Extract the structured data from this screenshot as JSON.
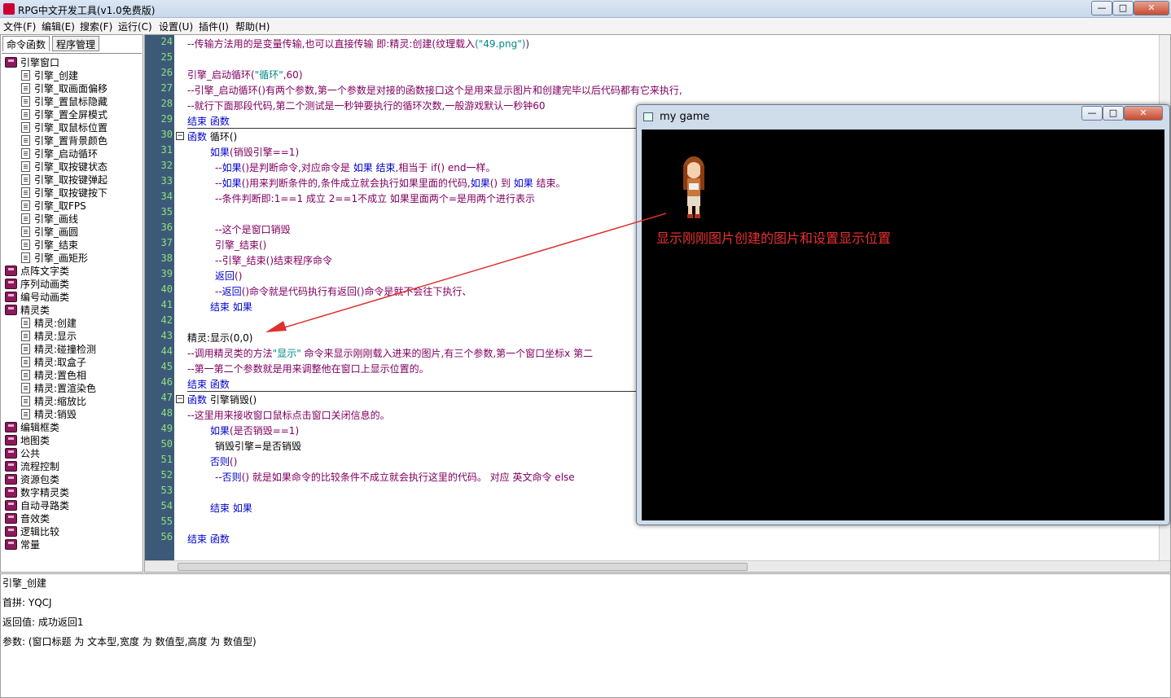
{
  "window": {
    "title": "RPG中文开发工具(v1.0免费版)",
    "min": "—",
    "max": "□",
    "close": "✕"
  },
  "menu": [
    "文件(F)",
    "编辑(E)",
    "搜索(F)",
    "运行(C)",
    "设置(U)",
    "插件(I)",
    "帮助(H)"
  ],
  "left_tabs": [
    "命令函数",
    "程序管理"
  ],
  "tree": [
    {
      "label": "引擎窗口",
      "type": "book",
      "level": 0
    },
    {
      "label": "引擎_创建",
      "type": "doc",
      "level": 1
    },
    {
      "label": "引擎_取画面偏移",
      "type": "doc",
      "level": 1
    },
    {
      "label": "引擎_置鼠标隐藏",
      "type": "doc",
      "level": 1
    },
    {
      "label": "引擎_置全屏模式",
      "type": "doc",
      "level": 1
    },
    {
      "label": "引擎_取鼠标位置",
      "type": "doc",
      "level": 1
    },
    {
      "label": "引擎_置背景颜色",
      "type": "doc",
      "level": 1
    },
    {
      "label": "引擎_启动循环",
      "type": "doc",
      "level": 1
    },
    {
      "label": "引擎_取按键状态",
      "type": "doc",
      "level": 1
    },
    {
      "label": "引擎_取按键弹起",
      "type": "doc",
      "level": 1
    },
    {
      "label": "引擎_取按键按下",
      "type": "doc",
      "level": 1
    },
    {
      "label": "引擎_取FPS",
      "type": "doc",
      "level": 1
    },
    {
      "label": "引擎_画线",
      "type": "doc",
      "level": 1
    },
    {
      "label": "引擎_画圆",
      "type": "doc",
      "level": 1
    },
    {
      "label": "引擎_结束",
      "type": "doc",
      "level": 1
    },
    {
      "label": "引擎_画矩形",
      "type": "doc",
      "level": 1
    },
    {
      "label": "点阵文字类",
      "type": "book",
      "level": 0
    },
    {
      "label": "序列动画类",
      "type": "book",
      "level": 0
    },
    {
      "label": "编号动画类",
      "type": "book",
      "level": 0
    },
    {
      "label": "精灵类",
      "type": "book",
      "level": 0
    },
    {
      "label": "精灵:创建",
      "type": "doc",
      "level": 1
    },
    {
      "label": "精灵:显示",
      "type": "doc",
      "level": 1
    },
    {
      "label": "精灵:碰撞检测",
      "type": "doc",
      "level": 1
    },
    {
      "label": "精灵:取盒子",
      "type": "doc",
      "level": 1
    },
    {
      "label": "精灵:置色相",
      "type": "doc",
      "level": 1
    },
    {
      "label": "精灵:置渲染色",
      "type": "doc",
      "level": 1
    },
    {
      "label": "精灵:缩放比",
      "type": "doc",
      "level": 1
    },
    {
      "label": "精灵:销毁",
      "type": "doc",
      "level": 1
    },
    {
      "label": "编辑框类",
      "type": "book",
      "level": 0
    },
    {
      "label": "地图类",
      "type": "book",
      "level": 0
    },
    {
      "label": "公共",
      "type": "book",
      "level": 0
    },
    {
      "label": "流程控制",
      "type": "book",
      "level": 0
    },
    {
      "label": "资源包类",
      "type": "book",
      "level": 0
    },
    {
      "label": "数字精灵类",
      "type": "book",
      "level": 0
    },
    {
      "label": "自动寻路类",
      "type": "book",
      "level": 0
    },
    {
      "label": "音效类",
      "type": "book",
      "level": 0
    },
    {
      "label": "逻辑比较",
      "type": "book",
      "level": 0
    },
    {
      "label": "常量",
      "type": "book",
      "level": 0
    }
  ],
  "code_lines": [
    {
      "n": "24",
      "indent": 0,
      "parts": [
        [
          "cm",
          "--传输方法用的是变量传输,也可以直接传输 即:精灵:创建("
        ],
        [
          "cm",
          "纹理载入"
        ],
        [
          "str",
          "(\"49.png\")"
        ],
        [
          "cm",
          ")"
        ]
      ]
    },
    {
      "n": "25",
      "indent": 0,
      "parts": []
    },
    {
      "n": "26",
      "indent": 0,
      "parts": [
        [
          "cm",
          "引擎_启动循环("
        ],
        [
          "str",
          "\"循环\""
        ],
        [
          "cm",
          ",60)"
        ]
      ]
    },
    {
      "n": "27",
      "indent": 0,
      "parts": [
        [
          "cm",
          "--引擎_启动循环()有两个参数,第一个参数是对接的函数接口这个是用来显示图片和创建完毕以后代码都有它来执行,"
        ]
      ]
    },
    {
      "n": "28",
      "indent": 0,
      "parts": [
        [
          "cm",
          "--就行下面那段代码,第二个测试是一秒钟要执行的循环次数,一般游戏默认一秒钟60"
        ]
      ]
    },
    {
      "n": "29",
      "indent": 0,
      "parts": [
        [
          "kw",
          "结束 函数"
        ]
      ]
    },
    {
      "n": "30",
      "indent": 0,
      "parts": [
        [
          "kw",
          "函数"
        ],
        [
          "plain",
          " 循环()"
        ]
      ]
    },
    {
      "n": "31",
      "indent": 28,
      "parts": [
        [
          "kw",
          "如果"
        ],
        [
          "cm",
          "(销毁引擎==1)"
        ]
      ]
    },
    {
      "n": "32",
      "indent": 34,
      "parts": [
        [
          "cm",
          "--"
        ],
        [
          "kw",
          "如果"
        ],
        [
          "cm",
          "()是判断命令,对应命令是 "
        ],
        [
          "kw",
          "如果 结束"
        ],
        [
          "cm",
          ",相当于 if() end一样。"
        ]
      ]
    },
    {
      "n": "33",
      "indent": 34,
      "parts": [
        [
          "cm",
          "--"
        ],
        [
          "kw",
          "如果"
        ],
        [
          "cm",
          "()用来判断条件的,条件成立就会执行如果里面的代码,"
        ],
        [
          "kw",
          "如果"
        ],
        [
          "cm",
          "() 到 "
        ],
        [
          "kw",
          "如果"
        ],
        [
          "cm",
          " 结束。"
        ]
      ]
    },
    {
      "n": "34",
      "indent": 34,
      "parts": [
        [
          "cm",
          "--条件判断即:1==1 成立  2==1不成立 如果里面两个=是用两个进行表示"
        ]
      ]
    },
    {
      "n": "35",
      "indent": 34,
      "parts": []
    },
    {
      "n": "36",
      "indent": 34,
      "parts": [
        [
          "cm",
          "--这个是窗口销毁"
        ]
      ]
    },
    {
      "n": "37",
      "indent": 34,
      "parts": [
        [
          "cm",
          "引擎_结束()"
        ]
      ]
    },
    {
      "n": "38",
      "indent": 34,
      "parts": [
        [
          "cm",
          "--引擎_结束()结束程序命令"
        ]
      ]
    },
    {
      "n": "39",
      "indent": 34,
      "parts": [
        [
          "kw",
          "返回"
        ],
        [
          "cm",
          "()"
        ]
      ]
    },
    {
      "n": "40",
      "indent": 34,
      "parts": [
        [
          "cm",
          "--"
        ],
        [
          "kw",
          "返回"
        ],
        [
          "cm",
          "()命令就是代码执行有返回()命令是就不会往下执行、"
        ]
      ]
    },
    {
      "n": "41",
      "indent": 28,
      "parts": [
        [
          "kw",
          "结束 如果"
        ]
      ]
    },
    {
      "n": "42",
      "indent": 0,
      "parts": []
    },
    {
      "n": "43",
      "indent": 0,
      "parts": [
        [
          "plain",
          "精灵:显示(0,0)"
        ]
      ]
    },
    {
      "n": "44",
      "indent": 0,
      "parts": [
        [
          "cm",
          "--调用精灵类的方法"
        ],
        [
          "str",
          "\"显示\""
        ],
        [
          "cm",
          " 命令来显示刚刚载入进来的图片,有三个参数,第一个窗口坐标x 第二"
        ]
      ]
    },
    {
      "n": "45",
      "indent": 0,
      "parts": [
        [
          "cm",
          "--第一第二个参数就是用来调整他在窗口上显示位置的。"
        ]
      ]
    },
    {
      "n": "46",
      "indent": 0,
      "parts": [
        [
          "kw",
          "结束 函数"
        ]
      ]
    },
    {
      "n": "47",
      "indent": 0,
      "parts": [
        [
          "kw",
          "函数"
        ],
        [
          "plain",
          " 引擎销毁()"
        ]
      ]
    },
    {
      "n": "48",
      "indent": 0,
      "parts": [
        [
          "cm",
          "--这里用来接收窗口鼠标点击窗口关闭信息的。"
        ]
      ]
    },
    {
      "n": "49",
      "indent": 28,
      "parts": [
        [
          "kw",
          "如果"
        ],
        [
          "cm",
          "(是否销毁==1)"
        ]
      ]
    },
    {
      "n": "50",
      "indent": 34,
      "parts": [
        [
          "plain",
          "销毁引擎=是否销毁"
        ]
      ]
    },
    {
      "n": "51",
      "indent": 28,
      "parts": [
        [
          "kw",
          "否则"
        ],
        [
          "cm",
          "()"
        ]
      ]
    },
    {
      "n": "52",
      "indent": 34,
      "parts": [
        [
          "cm",
          "--"
        ],
        [
          "kw",
          "否则"
        ],
        [
          "cm",
          "() 就是如果命令的比较条件不成立就会执行这里的代码。 对应 英文命令 else"
        ]
      ]
    },
    {
      "n": "53",
      "indent": 34,
      "parts": []
    },
    {
      "n": "54",
      "indent": 28,
      "parts": [
        [
          "kw",
          "结束 如果"
        ]
      ]
    },
    {
      "n": "55",
      "indent": 0,
      "parts": []
    },
    {
      "n": "56",
      "indent": 0,
      "parts": [
        [
          "kw",
          "结束 函数"
        ]
      ]
    }
  ],
  "bottom": {
    "name": "引擎_创建",
    "pinyin": "首拼: YQCJ",
    "retval": "返回值: 成功返回1",
    "params": "参数: (窗口标题 为 文本型,宽度 为 数值型,高度 为 数值型)"
  },
  "game": {
    "title": "my game",
    "caption": "显示刚刚图片创建的图片和设置显示位置"
  },
  "colors": {
    "gutter": "#3c5a78",
    "line_numbers": "#8fe07f",
    "keyword": "#0000cc",
    "comment": "#800060",
    "string": "#008888",
    "caption": "#e83030",
    "arrow": "#e03030"
  },
  "icons": [
    "app-icon",
    "book-icon",
    "doc-icon",
    "fold-icon"
  ]
}
